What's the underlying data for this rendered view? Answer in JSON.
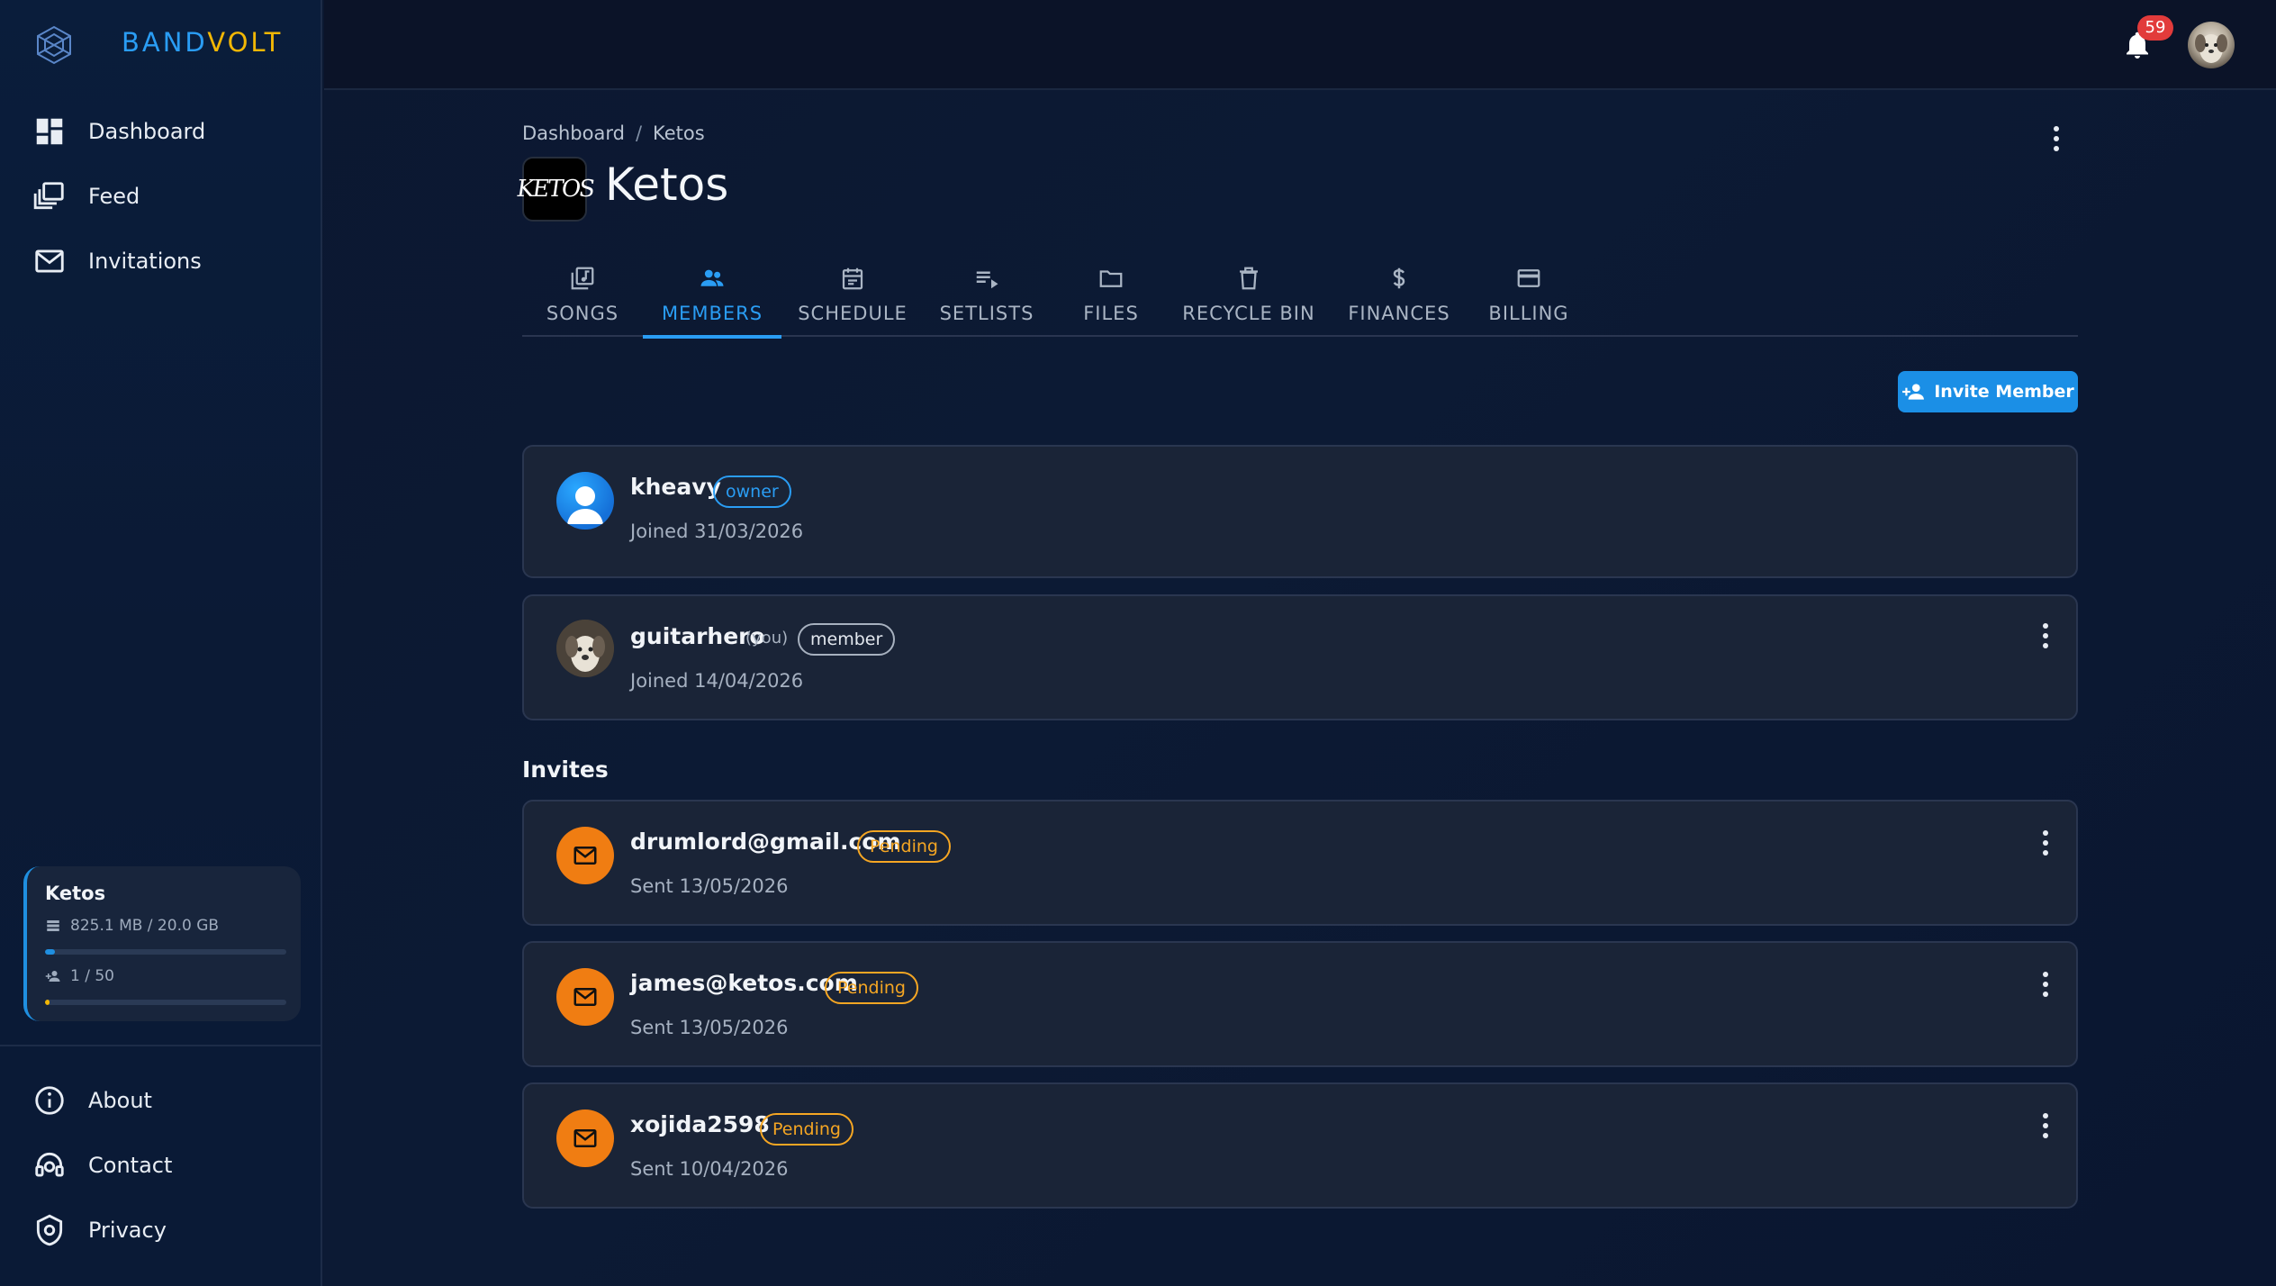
{
  "app": {
    "brand_part1": "BAND",
    "brand_part2": "VOLT"
  },
  "sidebar": {
    "nav": [
      {
        "label": "Dashboard",
        "icon": "dashboard-icon"
      },
      {
        "label": "Feed",
        "icon": "feed-icon"
      },
      {
        "label": "Invitations",
        "icon": "mail-icon"
      }
    ],
    "quota": {
      "band_name": "Ketos",
      "storage_text": "825.1 MB / 20.0 GB",
      "storage_fraction": 0.04,
      "members_text": "1 / 50",
      "members_fraction": 0.02
    },
    "footer": [
      {
        "label": "About",
        "icon": "info-icon"
      },
      {
        "label": "Contact",
        "icon": "support-icon"
      },
      {
        "label": "Privacy",
        "icon": "shield-icon"
      }
    ]
  },
  "topbar": {
    "notification_count": "59"
  },
  "breadcrumb": {
    "root": "Dashboard",
    "separator": "/",
    "current": "Ketos"
  },
  "band": {
    "name": "Ketos",
    "logo_text": "KETOS"
  },
  "tabs": [
    {
      "label": "SONGS",
      "icon": "music-library-icon",
      "active": false
    },
    {
      "label": "MEMBERS",
      "icon": "group-icon",
      "active": true
    },
    {
      "label": "SCHEDULE",
      "icon": "calendar-icon",
      "active": false
    },
    {
      "label": "SETLISTS",
      "icon": "playlist-icon",
      "active": false
    },
    {
      "label": "FILES",
      "icon": "folder-icon",
      "active": false
    },
    {
      "label": "RECYCLE BIN",
      "icon": "trash-icon",
      "active": false
    },
    {
      "label": "FINANCES",
      "icon": "dollar-icon",
      "active": false
    },
    {
      "label": "BILLING",
      "icon": "credit-card-icon",
      "active": false
    }
  ],
  "actions": {
    "invite_label": "Invite Member"
  },
  "members": [
    {
      "name": "kheavy",
      "you_label": "",
      "role": "owner",
      "joined": "Joined 31/03/2026"
    },
    {
      "name": "guitarhero",
      "you_label": "(you)",
      "role": "member",
      "joined": "Joined 14/04/2026"
    }
  ],
  "invites_title": "Invites",
  "invites": [
    {
      "email": "drumlord@gmail.com",
      "status": "Pending",
      "sent": "Sent 13/05/2026"
    },
    {
      "email": "james@ketos.com",
      "status": "Pending",
      "sent": "Sent 13/05/2026"
    },
    {
      "email": "xojida2598",
      "status": "Pending",
      "sent": "Sent 10/04/2026"
    }
  ],
  "colors": {
    "accent_blue": "#2a9df4",
    "brand_yellow": "#f2b705",
    "pending_orange": "#f5a623",
    "mail_orange": "#f07d12",
    "badge_red": "#e23b3b"
  }
}
